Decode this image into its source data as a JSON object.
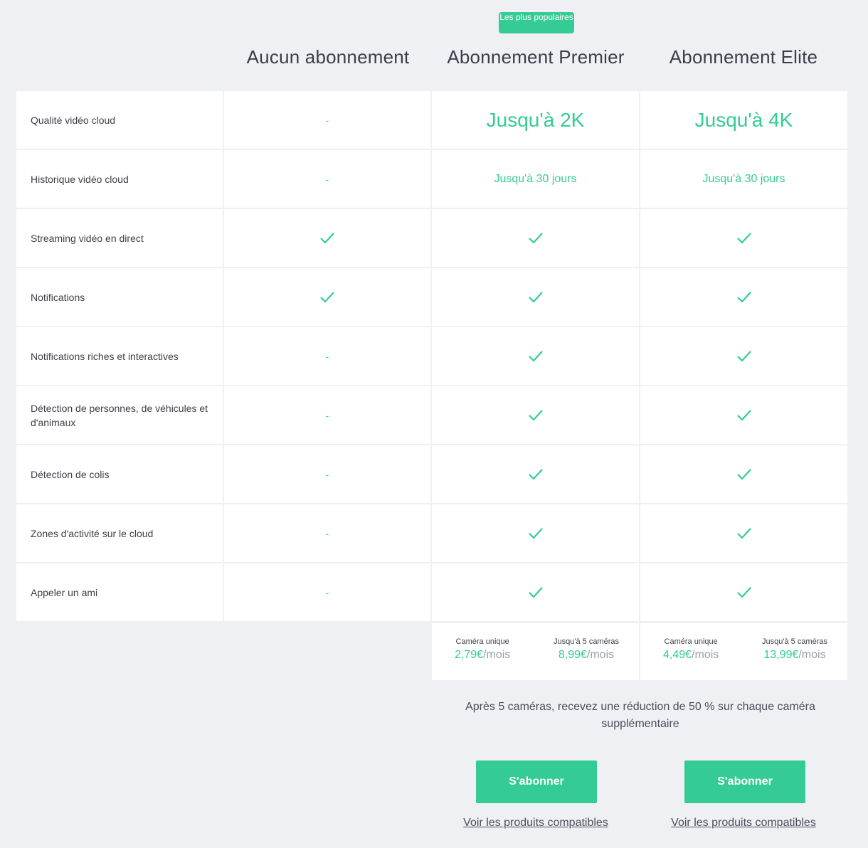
{
  "badge": "Les plus populaires",
  "plans": [
    {
      "title": "Aucun abonnement"
    },
    {
      "title": "Abonnement Premier"
    },
    {
      "title": "Abonnement Elite"
    }
  ],
  "features": [
    {
      "label": "Qualité vidéo cloud",
      "values": [
        "-",
        "Jusqu'à 2K",
        "Jusqu'à 4K"
      ]
    },
    {
      "label": "Historique vidéo cloud",
      "values": [
        "-",
        "Jusqu'à 30 jours",
        "Jusqu'à 30 jours"
      ]
    },
    {
      "label": "Streaming vidéo en direct",
      "values": [
        "check",
        "check",
        "check"
      ]
    },
    {
      "label": "Notifications",
      "values": [
        "check",
        "check",
        "check"
      ]
    },
    {
      "label": "Notifications riches et interactives",
      "values": [
        "-",
        "check",
        "check"
      ]
    },
    {
      "label": "Détection de personnes, de véhicules et d'animaux",
      "values": [
        "-",
        "check",
        "check"
      ]
    },
    {
      "label": "Détection de colis",
      "values": [
        "-",
        "check",
        "check"
      ]
    },
    {
      "label": "Zones d'activité sur le cloud",
      "values": [
        "-",
        "check",
        "check"
      ]
    },
    {
      "label": "Appeler un ami",
      "values": [
        "-",
        "check",
        "check"
      ]
    }
  ],
  "pricing": [
    {
      "single_label": "Caméra unique",
      "single_price": "2,79€",
      "single_unit": "/mois",
      "multi_label": "Jusqu'à 5 caméras",
      "multi_price": "8,99€",
      "multi_unit": "/mois"
    },
    {
      "single_label": "Caméra unique",
      "single_price": "4,49€",
      "single_unit": "/mois",
      "multi_label": "Jusqu'à 5 caméras",
      "multi_price": "13,99€",
      "multi_unit": "/mois"
    }
  ],
  "note": "Après 5 caméras, recevez une réduction de 50 % sur chaque caméra supplémentaire",
  "cta": {
    "subscribe": "S'abonner",
    "compatible": "Voir les produits compatibles"
  },
  "colors": {
    "accent": "#34cc94",
    "background": "#eff0f4"
  }
}
